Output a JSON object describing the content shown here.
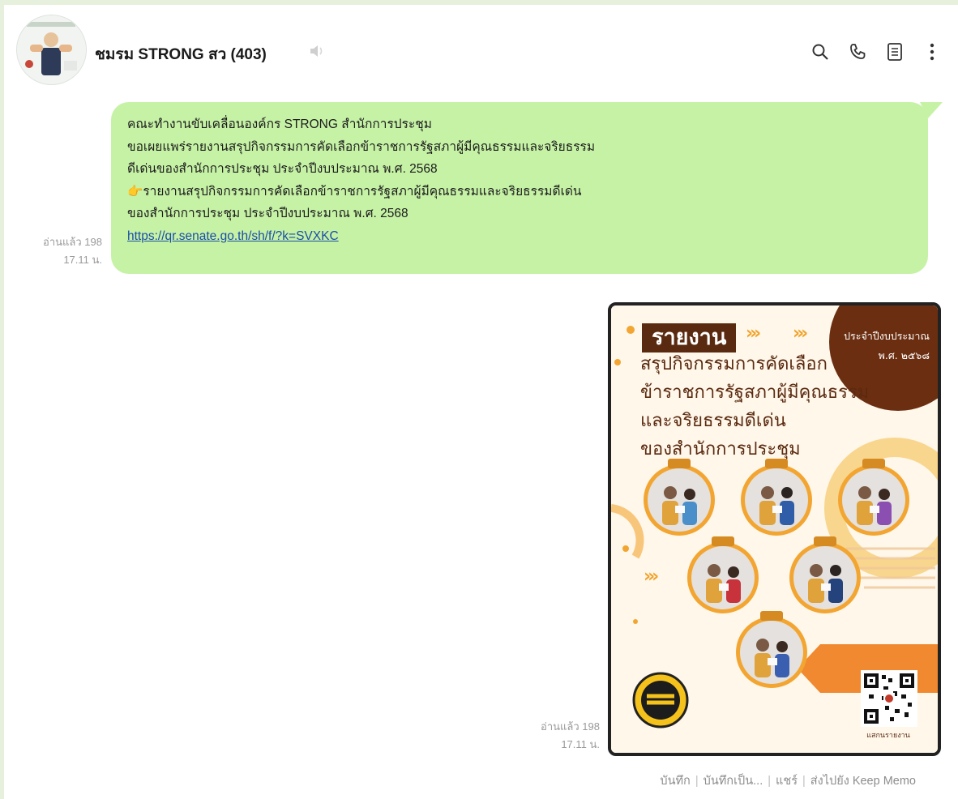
{
  "chat": {
    "title": "ชมรม STRONG สว (403)"
  },
  "message": {
    "lines": [
      "คณะทำงานขับเคลื่อนองค์กร STRONG สำนักการประชุม",
      "ขอเผยแพร่รายงานสรุปกิจกรรมการคัดเลือกข้าราชการรัฐสภาผู้มีคุณธรรมและจริยธรรม",
      "ดีเด่นของสำนักการประชุม ประจำปีงบประมาณ พ.ศ. 2568",
      "รายงานสรุปกิจกรรมการคัดเลือกข้าราชการรัฐสภาผู้มีคุณธรรมและจริยธรรมดีเด่น",
      "ของสำนักการประชุม ประจำปีงบประมาณ พ.ศ. 2568"
    ],
    "emoji": "👉",
    "link": "https://qr.senate.go.th/sh/f/?k=SVXKC",
    "read": "อ่านแล้ว 198",
    "time": "17.11 น."
  },
  "image_message": {
    "read": "อ่านแล้ว 198",
    "time": "17.11 น.",
    "poster": {
      "tag": "รายงาน",
      "badge_line1": "ประจำปีงบประมาณ",
      "badge_line2": "พ.ศ. ๒๕๖๘",
      "heading": [
        "สรุปกิจกรรมการคัดเลือก",
        "ข้าราชการรัฐสภาผู้มีคุณธรรม",
        "และจริยธรรมดีเด่น",
        "ของสำนักการประชุม"
      ],
      "qr_caption": "แสกนรายงาน"
    }
  },
  "actions": {
    "save": "บันทึก",
    "save_as": "บันทึกเป็น...",
    "share": "แชร์",
    "keep": "ส่งไปยัง Keep Memo"
  },
  "colors": {
    "bubble": "#c6f2a6",
    "link": "#1a4ea8",
    "poster_brown": "#5a2a10",
    "poster_orange": "#f3a531"
  },
  "icons": {
    "header": [
      "search-icon",
      "phone-icon",
      "notes-icon",
      "more-vertical-icon"
    ],
    "title_suffix": "speaker-muted-icon"
  }
}
